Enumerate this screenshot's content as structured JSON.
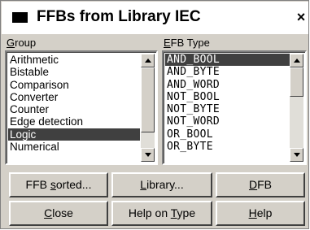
{
  "window": {
    "title": "FFBs from Library IEC",
    "close_label": "×"
  },
  "group": {
    "label_accel": "G",
    "label_rest": "roup",
    "items": [
      "Arithmetic",
      "Bistable",
      "Comparison",
      "Converter",
      "Counter",
      "Edge detection",
      "Logic",
      "Numerical"
    ],
    "selected": "Logic"
  },
  "efb": {
    "label_accel": "E",
    "label_rest": "FB Type",
    "items": [
      "AND_BOOL",
      "AND_BYTE",
      "AND_WORD",
      "NOT_BOOL",
      "NOT_BYTE",
      "NOT_WORD",
      "OR_BOOL",
      "OR_BYTE"
    ],
    "selected": "AND_BOOL"
  },
  "buttons": {
    "ffb_sorted": {
      "pre": "FFB ",
      "accel": "s",
      "post": "orted..."
    },
    "library": {
      "pre": "",
      "accel": "L",
      "post": "ibrary..."
    },
    "dfb": {
      "pre": "",
      "accel": "D",
      "post": "FB"
    },
    "close": {
      "pre": "",
      "accel": "C",
      "post": "lose"
    },
    "help_on_type": {
      "pre": "Help on ",
      "accel": "T",
      "post": "ype"
    },
    "help": {
      "pre": "",
      "accel": "H",
      "post": "elp"
    }
  }
}
